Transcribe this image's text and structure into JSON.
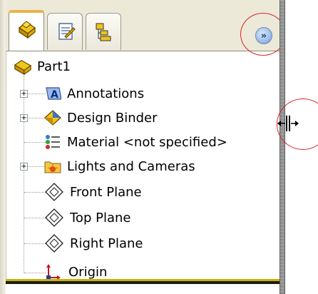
{
  "tabs": [
    {
      "icon": "feature-manager-icon",
      "active": true
    },
    {
      "icon": "property-manager-icon",
      "active": false
    },
    {
      "icon": "configuration-manager-icon",
      "active": false
    }
  ],
  "collapse_button": {
    "label": "»",
    "icon": "double-chevron-right-icon"
  },
  "tree": {
    "root": {
      "label": "Part1",
      "icon": "part-icon"
    },
    "items": [
      {
        "label": "Annotations",
        "icon": "annotations-icon",
        "expandable": true
      },
      {
        "label": "Design Binder",
        "icon": "design-binder-icon",
        "expandable": true
      },
      {
        "label": "Material <not specified>",
        "icon": "material-icon",
        "expandable": false
      },
      {
        "label": "Lights and Cameras",
        "icon": "lights-cameras-icon",
        "expandable": true
      },
      {
        "label": "Front Plane",
        "icon": "plane-icon",
        "expandable": false
      },
      {
        "label": "Top Plane",
        "icon": "plane-icon",
        "expandable": false
      },
      {
        "label": "Right Plane",
        "icon": "plane-icon",
        "expandable": false
      },
      {
        "label": "Origin",
        "icon": "origin-icon",
        "expandable": false
      }
    ],
    "expander_symbol": "+"
  },
  "colors": {
    "highlight_circle": "#d8242c",
    "active_tab_accent": "#e9b348"
  }
}
